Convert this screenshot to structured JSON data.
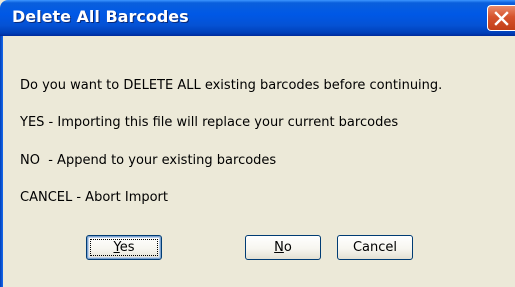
{
  "dialog": {
    "title": "Delete All Barcodes",
    "messages": [
      "Do you want to DELETE ALL existing barcodes before continuing.",
      "YES - Importing this file will replace your current barcodes",
      "NO  - Append to your existing barcodes",
      "CANCEL - Abort Import"
    ],
    "buttons": {
      "yes": "Yes",
      "no": "No",
      "cancel": "Cancel"
    },
    "icons": {
      "close": "close-icon"
    },
    "colors": {
      "titlebar": "#0058e6",
      "close_button": "#d6532d",
      "background": "#ece9d8"
    }
  }
}
